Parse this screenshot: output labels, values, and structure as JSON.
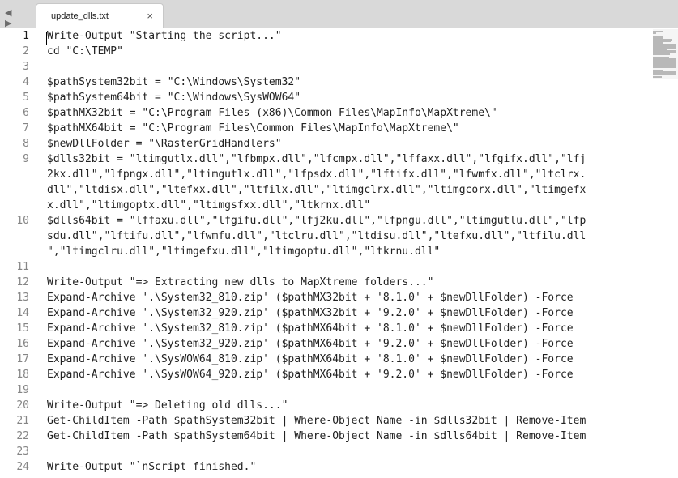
{
  "tab": {
    "title": "update_dlls.txt",
    "close_glyph": "×"
  },
  "nav": {
    "arrows": "◀ ▶"
  },
  "editor": {
    "active_line": 1,
    "lines": [
      {
        "n": "1",
        "text": "Write-Output \"Starting the script...\""
      },
      {
        "n": "2",
        "text": "cd \"C:\\TEMP\""
      },
      {
        "n": "3",
        "text": ""
      },
      {
        "n": "4",
        "text": "$pathSystem32bit = \"C:\\Windows\\System32\""
      },
      {
        "n": "5",
        "text": "$pathSystem64bit = \"C:\\Windows\\SysWOW64\""
      },
      {
        "n": "6",
        "text": "$pathMX32bit = \"C:\\Program Files (x86)\\Common Files\\MapInfo\\MapXtreme\\\""
      },
      {
        "n": "7",
        "text": "$pathMX64bit = \"C:\\Program Files\\Common Files\\MapInfo\\MapXtreme\\\""
      },
      {
        "n": "8",
        "text": "$newDllFolder = \"\\RasterGridHandlers\""
      },
      {
        "n": "9",
        "text": "$dlls32bit = \"ltimgutlx.dll\",\"lfbmpx.dll\",\"lfcmpx.dll\",\"lffaxx.dll\",\"lfgifx.dll\",\"lfj"
      },
      {
        "n": "",
        "text": "2kx.dll\",\"lfpngx.dll\",\"ltimgutlx.dll\",\"lfpsdx.dll\",\"lftifx.dll\",\"lfwmfx.dll\",\"ltclrx."
      },
      {
        "n": "",
        "text": "dll\",\"ltdisx.dll\",\"ltefxx.dll\",\"ltfilx.dll\",\"ltimgclrx.dll\",\"ltimgcorx.dll\",\"ltimgefx"
      },
      {
        "n": "",
        "text": "x.dll\",\"ltimgoptx.dll\",\"ltimgsfxx.dll\",\"ltkrnx.dll\""
      },
      {
        "n": "10",
        "text": "$dlls64bit = \"lffaxu.dll\",\"lfgifu.dll\",\"lfj2ku.dll\",\"lfpngu.dll\",\"ltimgutlu.dll\",\"lfp"
      },
      {
        "n": "",
        "text": "sdu.dll\",\"lftifu.dll\",\"lfwmfu.dll\",\"ltclru.dll\",\"ltdisu.dll\",\"ltefxu.dll\",\"ltfilu.dll"
      },
      {
        "n": "",
        "text": "\",\"ltimgclru.dll\",\"ltimgefxu.dll\",\"ltimgoptu.dll\",\"ltkrnu.dll\""
      },
      {
        "n": "11",
        "text": ""
      },
      {
        "n": "12",
        "text": "Write-Output \"=> Extracting new dlls to MapXtreme folders...\""
      },
      {
        "n": "13",
        "text": "Expand-Archive '.\\System32_810.zip' ($pathMX32bit + '8.1.0' + $newDllFolder) -Force"
      },
      {
        "n": "14",
        "text": "Expand-Archive '.\\System32_920.zip' ($pathMX32bit + '9.2.0' + $newDllFolder) -Force"
      },
      {
        "n": "15",
        "text": "Expand-Archive '.\\System32_810.zip' ($pathMX64bit + '8.1.0' + $newDllFolder) -Force"
      },
      {
        "n": "16",
        "text": "Expand-Archive '.\\System32_920.zip' ($pathMX64bit + '9.2.0' + $newDllFolder) -Force"
      },
      {
        "n": "17",
        "text": "Expand-Archive '.\\SysWOW64_810.zip' ($pathMX64bit + '8.1.0' + $newDllFolder) -Force"
      },
      {
        "n": "18",
        "text": "Expand-Archive '.\\SysWOW64_920.zip' ($pathMX64bit + '9.2.0' + $newDllFolder) -Force"
      },
      {
        "n": "19",
        "text": ""
      },
      {
        "n": "20",
        "text": "Write-Output \"=> Deleting old dlls...\""
      },
      {
        "n": "21",
        "text": "Get-ChildItem -Path $pathSystem32bit | Where-Object Name -in $dlls32bit | Remove-Item"
      },
      {
        "n": "22",
        "text": "Get-ChildItem -Path $pathSystem64bit | Where-Object Name -in $dlls64bit | Remove-Item"
      },
      {
        "n": "23",
        "text": ""
      },
      {
        "n": "24",
        "text": "Write-Output \"`nScript finished.\""
      }
    ]
  }
}
